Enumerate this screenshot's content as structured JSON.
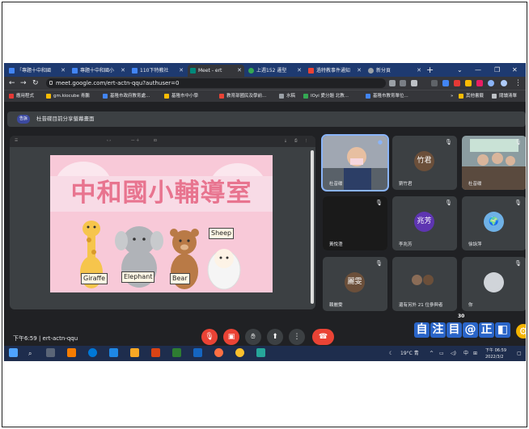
{
  "browser": {
    "tabs": [
      {
        "title": "「專題十中和國",
        "color": "#4285f4"
      },
      {
        "title": "專題十中和國小",
        "color": "#4285f4"
      },
      {
        "title": "110下特教社",
        "color": "#4285f4"
      },
      {
        "title": "Meet - ert",
        "color": "#00897b",
        "active": true
      },
      {
        "title": "上週152 遷型",
        "color": "#34a853"
      },
      {
        "title": "過特教事件通知",
        "color": "#ea4335"
      },
      {
        "title": "新分頁",
        "color": "#9aa0a6"
      }
    ],
    "new_tab": "+",
    "url": "meet.google.com/ert-actn-qqu?authuser=0",
    "bookmarks": [
      "應用程式",
      "gm.kiocube 青鵬",
      "基隆市政府教育處...",
      "基隆市中小學",
      "教育部國民及學前...",
      "水稿",
      "IOyi 愛分題 北教...",
      "基隆市教育單位...",
      "其他書籤",
      "閱讀清單"
    ]
  },
  "meet": {
    "badge": "告訴",
    "presenting_text": "杜昔碟目前分享螢幕畫面",
    "slide": {
      "title": "中和國小輔導室",
      "signs": [
        "Giraffe",
        "Elephant",
        "Bear",
        "Sheep"
      ]
    },
    "participants": [
      {
        "name": "杜昔碟",
        "initials": "",
        "speaking": true
      },
      {
        "name": "劉竹君",
        "initials": "竹君",
        "color": "#6b4f3a"
      },
      {
        "name": "杜昔碟",
        "initials": ""
      },
      {
        "name": "黃悅澄",
        "initials": ""
      },
      {
        "name": "李兆芳",
        "initials": "兆芳",
        "color": "#5e35b1"
      },
      {
        "name": "徐詠萍",
        "initials": ""
      },
      {
        "name": "賴麗雯",
        "initials": "麗雯",
        "color": "#6b4f3a"
      },
      {
        "name": "還有另外 21 位參與者",
        "initials": ""
      },
      {
        "name": "你",
        "initials": ""
      }
    ],
    "time": "下午6:59",
    "meeting_code": "ert-actn-qqu",
    "ime_chars": [
      "自",
      "注",
      "目",
      "@",
      "正",
      "◧"
    ],
    "ime_count": "30"
  },
  "taskbar": {
    "weather": "19°C 青",
    "lang": "中",
    "clock_time": "下午 06:59",
    "clock_date": "2022/3/2"
  },
  "colors": {
    "accent": "#8ab4f8",
    "danger": "#ea4335",
    "slide_title": "#e8748f"
  }
}
